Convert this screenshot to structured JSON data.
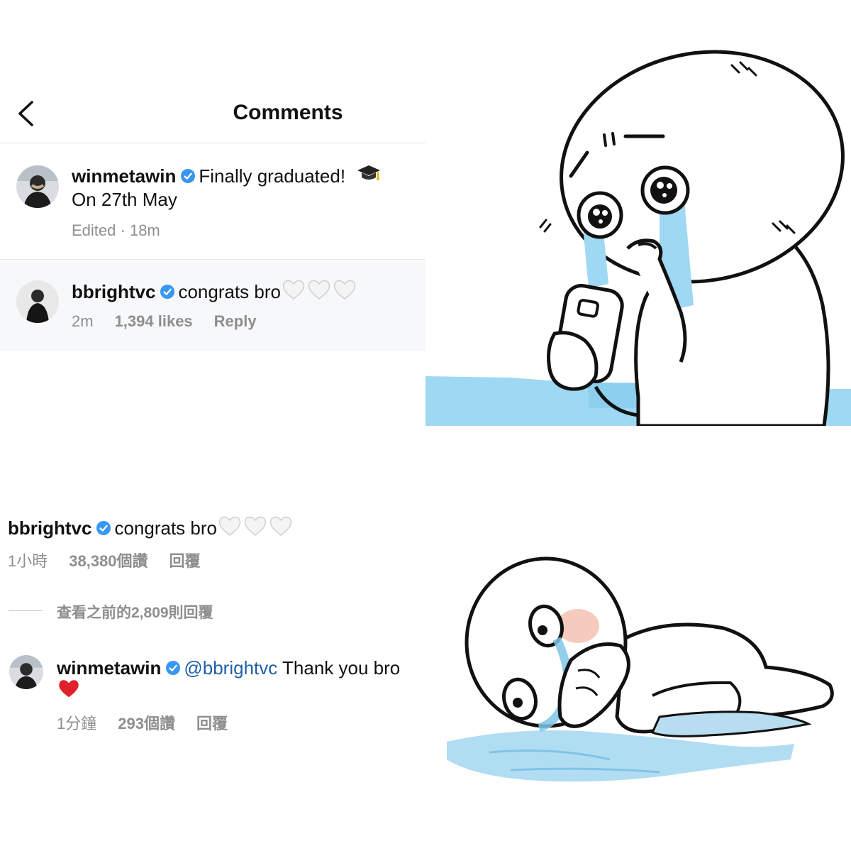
{
  "top_panel": {
    "header": {
      "title": "Comments",
      "back_icon": "chevron-left-icon"
    },
    "comments": [
      {
        "username": "winmetawin",
        "verified": true,
        "text": "Finally graduated!",
        "emoji": "graduation-cap-icon",
        "text_line2": "On 27th May",
        "edited": "Edited",
        "time": "18m"
      },
      {
        "username": "bbrightvc",
        "verified": true,
        "text": "congrats bro",
        "emoji": "white-heart-icon",
        "time": "2m",
        "likes": "1,394 likes",
        "reply": "Reply"
      }
    ]
  },
  "bottom_panel": {
    "comment": {
      "username": "bbrightvc",
      "verified": true,
      "text": "congrats bro",
      "emoji": "white-heart-icon",
      "time": "1小時",
      "likes": "38,380個讚",
      "reply": "回覆"
    },
    "view_previous": "查看之前的2,809則回覆",
    "reply_comment": {
      "username": "winmetawin",
      "verified": true,
      "mention": "@bbrightvc",
      "text": "Thank you bro",
      "emoji": "red-heart-icon",
      "time": "1分鐘",
      "likes": "293個讚",
      "reply": "回覆"
    }
  },
  "colors": {
    "verified_badge": "#3897f0",
    "meta_text": "#8e8e8e",
    "mention": "#1f5fa8",
    "tears_blue": "#9fd8f2"
  }
}
